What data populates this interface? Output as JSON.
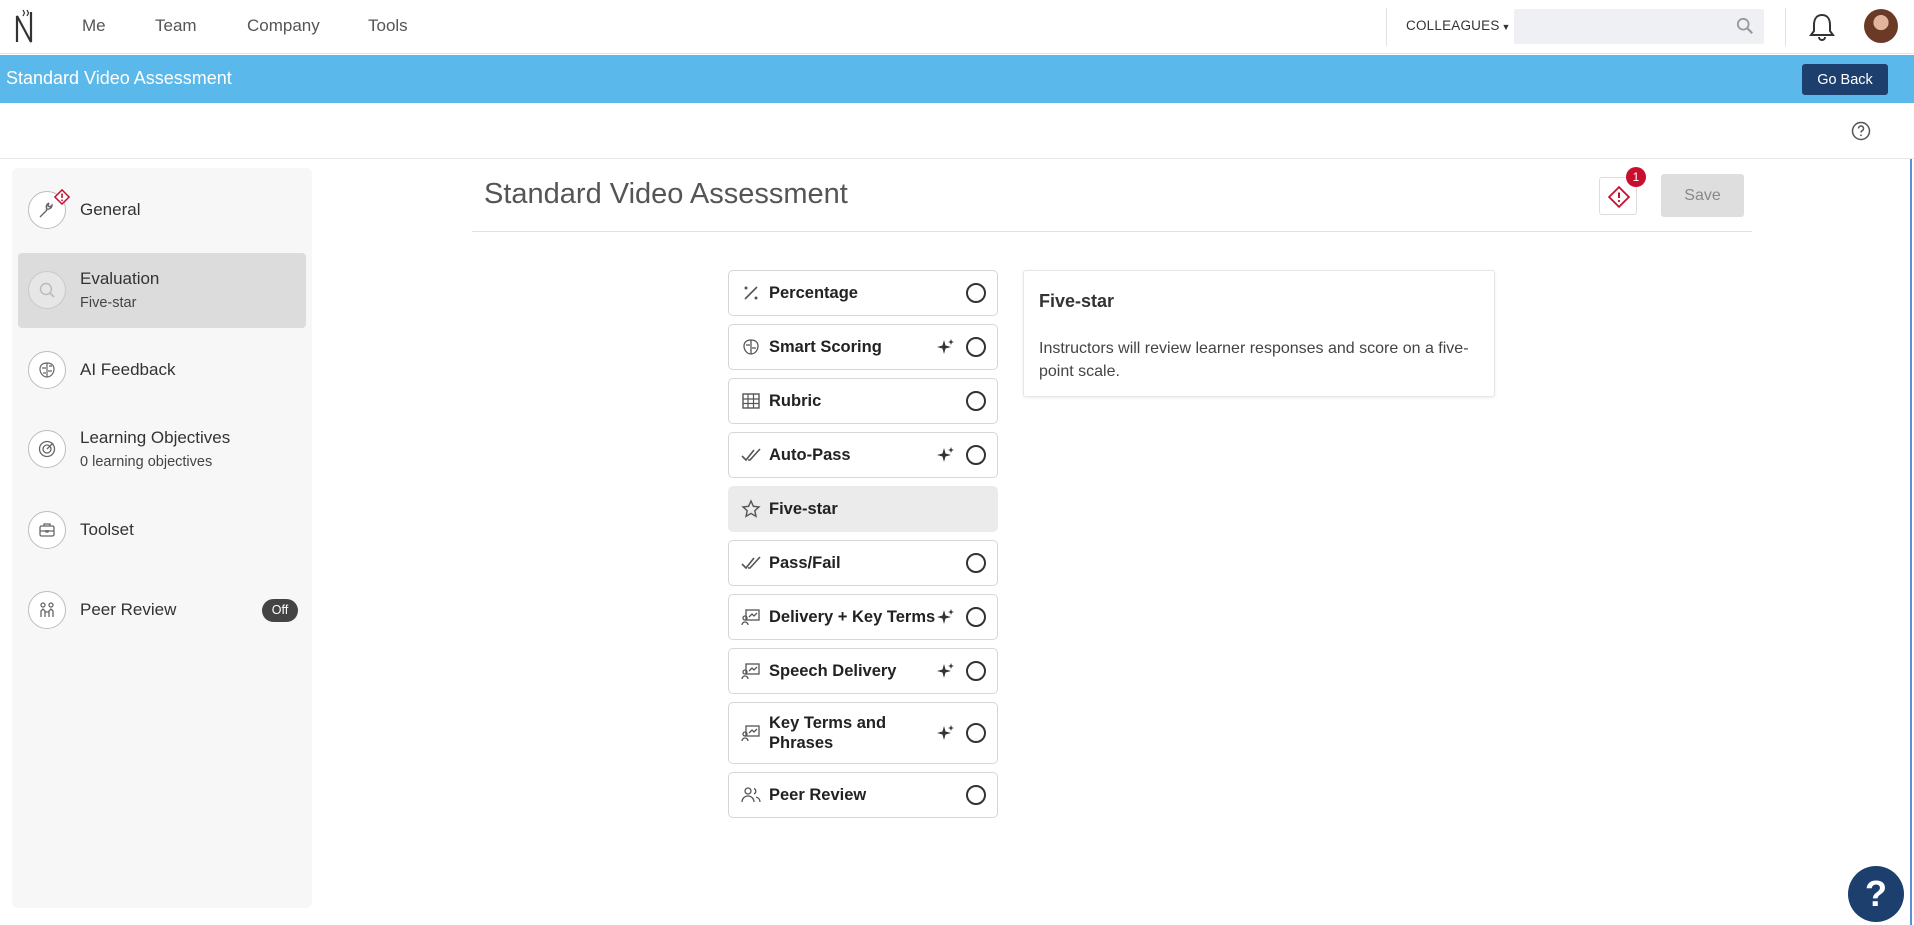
{
  "topnav": {
    "items": [
      {
        "label": "Me"
      },
      {
        "label": "Team"
      },
      {
        "label": "Company"
      },
      {
        "label": "Tools"
      }
    ],
    "colleagues_label": "COLLEAGUES",
    "search": {
      "placeholder": "",
      "value": ""
    }
  },
  "header": {
    "title": "Standard Video Assessment",
    "go_back_label": "Go Back"
  },
  "sidebar": {
    "items": [
      {
        "label": "General",
        "sublabel": "",
        "icon": "wrench-icon",
        "has_warning": true
      },
      {
        "label": "Evaluation",
        "sublabel": "Five-star",
        "icon": "magnifier-icon",
        "active": true
      },
      {
        "label": "AI Feedback",
        "sublabel": "",
        "icon": "brain-icon"
      },
      {
        "label": "Learning Objectives",
        "sublabel": "0 learning objectives",
        "icon": "target-icon"
      },
      {
        "label": "Toolset",
        "sublabel": "",
        "icon": "toolbox-icon"
      },
      {
        "label": "Peer Review",
        "sublabel": "",
        "icon": "people-icon",
        "badge": "Off"
      }
    ]
  },
  "main": {
    "title": "Standard Video Assessment",
    "warning_count": "1",
    "save_label": "Save",
    "options": [
      {
        "label": "Percentage",
        "icon": "percent-wand-icon",
        "ai": false,
        "selected": false
      },
      {
        "label": "Smart Scoring",
        "icon": "brain-icon",
        "ai": true,
        "selected": false
      },
      {
        "label": "Rubric",
        "icon": "grid-table-icon",
        "ai": false,
        "selected": false
      },
      {
        "label": "Auto-Pass",
        "icon": "double-check-icon",
        "ai": true,
        "selected": false
      },
      {
        "label": "Five-star",
        "icon": "star-icon",
        "ai": false,
        "selected": true
      },
      {
        "label": "Pass/Fail",
        "icon": "double-check-icon",
        "ai": false,
        "selected": false
      },
      {
        "label": "Delivery + Key Terms",
        "icon": "presentation-icon",
        "ai": true,
        "selected": false
      },
      {
        "label": "Speech Delivery",
        "icon": "presentation-icon",
        "ai": true,
        "selected": false
      },
      {
        "label": "Key Terms and Phrases",
        "icon": "presentation-icon",
        "ai": true,
        "selected": false
      },
      {
        "label": "Peer Review",
        "icon": "people-icon",
        "ai": false,
        "selected": false
      }
    ],
    "description": {
      "title": "Five-star",
      "text": "Instructors will review learner responses and score on a five-point scale."
    }
  },
  "help_fab_label": "?"
}
